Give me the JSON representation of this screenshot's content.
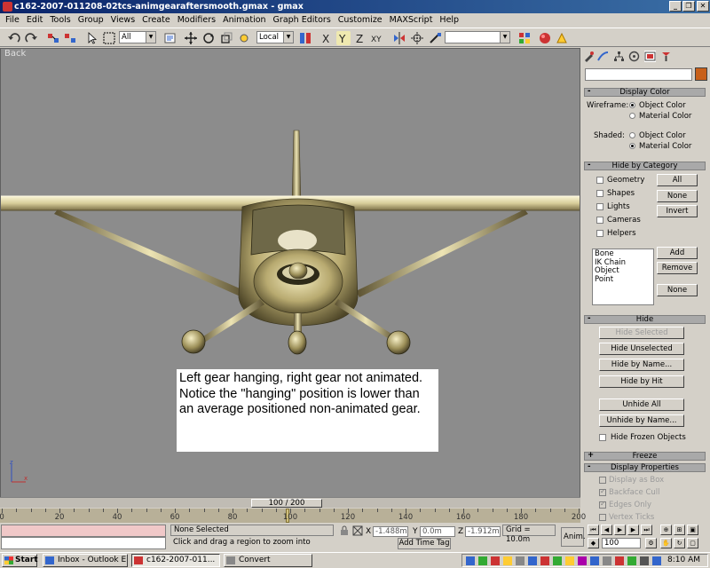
{
  "window": {
    "title": "c162-2007-011208-02tcs-animgearaftersmooth.gmax - gmax",
    "buttons": [
      "_",
      "❐",
      "✕"
    ]
  },
  "menu": [
    "File",
    "Edit",
    "Tools",
    "Group",
    "Views",
    "Create",
    "Modifiers",
    "Animation",
    "Graph Editors",
    "Customize",
    "MAXScript",
    "Help"
  ],
  "toolbar": {
    "selection_filter": "All",
    "ref_coord": "Local"
  },
  "viewport": {
    "label": "Back",
    "annotation": "Left gear hanging, right gear not animated.  Notice the \"hanging\" position is lower than an average positioned non-animated gear."
  },
  "command_panel": {
    "display_color": {
      "title": "Display Color",
      "wireframe_label": "Wireframe:",
      "shaded_label": "Shaded:",
      "options": [
        "Object Color",
        "Material Color"
      ],
      "wireframe_selected": "Object Color",
      "shaded_selected": "Material Color"
    },
    "hide_by_category": {
      "title": "Hide by Category",
      "checks": [
        "Geometry",
        "Shapes",
        "Lights",
        "Cameras",
        "Helpers"
      ],
      "buttons": [
        "All",
        "None",
        "Invert"
      ],
      "list": [
        "Bone",
        "IK Chain Object",
        "Point"
      ],
      "list_buttons": [
        "Add",
        "Remove",
        "None"
      ]
    },
    "hide": {
      "title": "Hide",
      "buttons": [
        "Hide Selected",
        "Hide Unselected",
        "Hide by Name...",
        "Hide by Hit",
        "Unhide All",
        "Unhide by Name..."
      ],
      "frozen_label": "Hide Frozen Objects"
    },
    "freeze": {
      "title": "Freeze",
      "sign": "+"
    },
    "display_properties": {
      "title": "Display Properties",
      "items": [
        "Display as Box",
        "Backface Cull",
        "Edges Only",
        "Vertex Ticks"
      ]
    },
    "rollout_minus": "-"
  },
  "timeline": {
    "slider_label": "100 / 200",
    "ticks": [
      "0",
      "20",
      "40",
      "60",
      "80",
      "100",
      "120",
      "140",
      "160",
      "180",
      "200"
    ]
  },
  "status": {
    "selection": "None Selected",
    "prompt": "Click and drag a region to zoom into",
    "x_label": "X",
    "y_label": "Y",
    "z_label": "Z",
    "x_value": "-1.488m",
    "y_value": "0.0m",
    "z_value": "-1.912m",
    "grid": "Grid = 10.0m",
    "add_time_tag": "Add Time Tag",
    "anim_label": "Anim.",
    "frame": "100"
  },
  "taskbar": {
    "start": "Start",
    "tasks": [
      "Inbox - Outlook E...",
      "c162-2007-011...",
      "Convert"
    ],
    "clock": "8:10 AM"
  }
}
